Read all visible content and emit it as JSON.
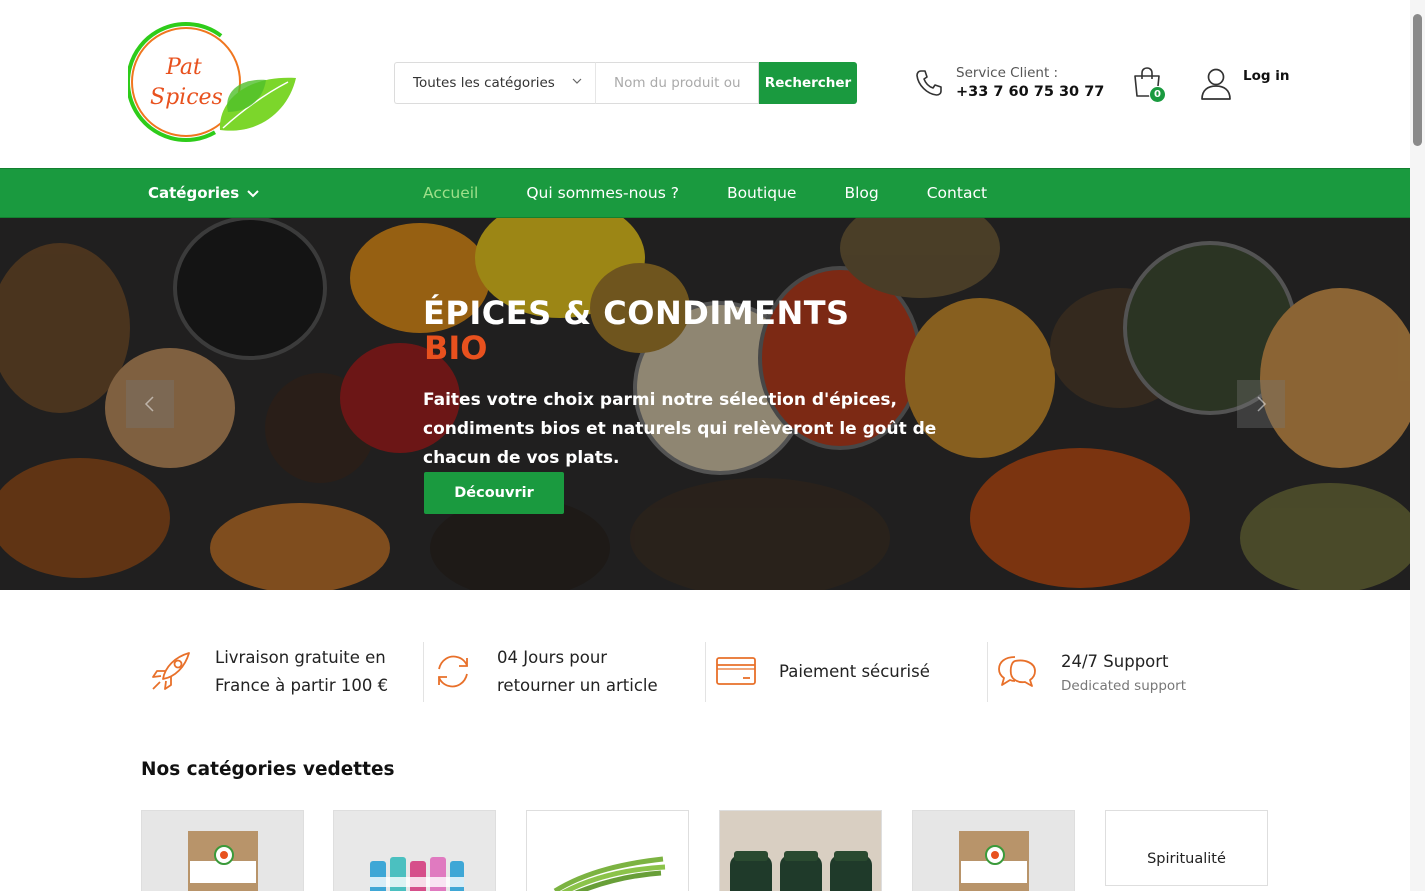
{
  "header": {
    "logo_text_line1": "Pat",
    "logo_text_line2": "Spices",
    "search": {
      "category_selected": "Toutes les catégories",
      "placeholder": "Nom du produit ou",
      "button_label": "Rechercher"
    },
    "service": {
      "label": "Service Client :",
      "phone": "+33 7 60 75 30 77"
    },
    "cart_count": "0",
    "login_label": "Log in"
  },
  "nav": {
    "categories_label": "Catégories",
    "items": [
      {
        "label": "Accueil",
        "active": true
      },
      {
        "label": "Qui sommes-nous ?"
      },
      {
        "label": "Boutique"
      },
      {
        "label": "Blog"
      },
      {
        "label": "Contact"
      }
    ]
  },
  "hero": {
    "title": "ÉPICES & CONDIMENTS",
    "highlight": "BIO",
    "text": "Faites votre choix parmi notre sélection d'épices, condiments bios et naturels qui relèveront le goût de chacun de vos plats.",
    "button": "Découvrir"
  },
  "features": [
    {
      "icon": "rocket-icon",
      "line1": "Livraison gratuite en",
      "line2": "France à partir 100 €"
    },
    {
      "icon": "refresh-icon",
      "line1": "04 Jours pour",
      "line2": "retourner un article"
    },
    {
      "icon": "credit-card-icon",
      "line1": "Paiement sécurisé"
    },
    {
      "icon": "chat-icon",
      "line1": "24/7 Support",
      "sub": "Dedicated support"
    }
  ],
  "categories": {
    "title": "Nos catégories vedettes",
    "items": [
      {
        "image": "spice-bag"
      },
      {
        "image": "bottles"
      },
      {
        "image": "green-herb"
      },
      {
        "image": "jars"
      },
      {
        "image": "spice-bag"
      },
      {
        "label": "Spiritualité"
      }
    ]
  },
  "colors": {
    "brand_green": "#1a9a3f",
    "accent_orange": "#e8511e",
    "active_nav": "#9fe08a"
  }
}
